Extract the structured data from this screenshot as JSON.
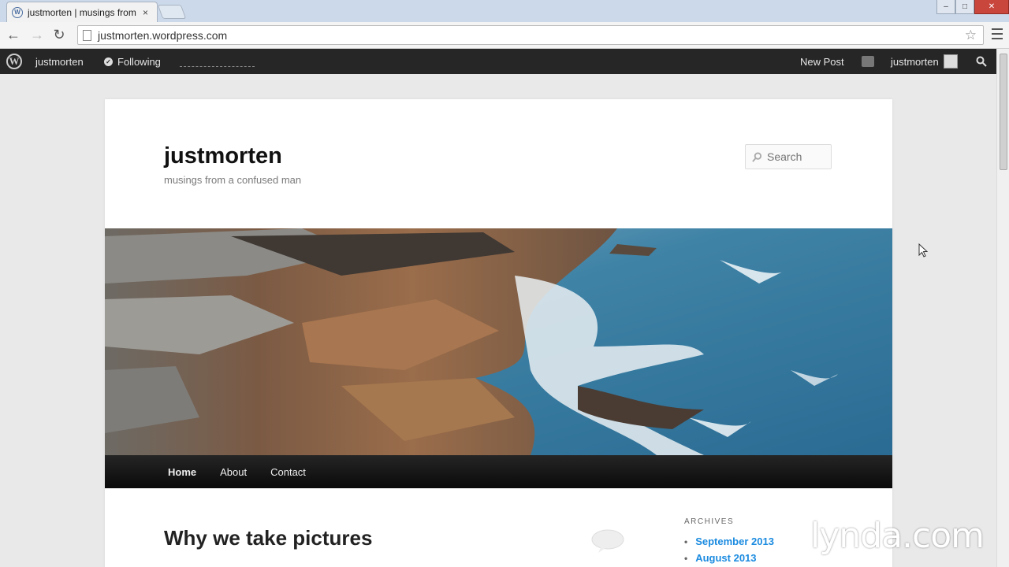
{
  "browser": {
    "tab_title": "justmorten | musings from",
    "tab_close": "×",
    "url": "justmorten.wordpress.com",
    "back": "←",
    "forward": "→",
    "reload": "↻",
    "star": "☆",
    "win_min": "–",
    "win_max": "□",
    "win_close": "✕"
  },
  "adminbar": {
    "site_name": "justmorten",
    "following": "Following",
    "new_post": "New Post",
    "user": "justmorten"
  },
  "site": {
    "title": "justmorten",
    "description": "musings from a confused man",
    "search_placeholder": "Search"
  },
  "nav": {
    "items": [
      {
        "label": "Home"
      },
      {
        "label": "About"
      },
      {
        "label": "Contact"
      }
    ]
  },
  "post": {
    "title": "Why we take pictures"
  },
  "sidebar": {
    "widget_title": "ARCHIVES",
    "archives": [
      "September 2013",
      "August 2013"
    ]
  },
  "watermark": "lynda.com",
  "colors": {
    "adminbar": "#262626",
    "link": "#1b8be0",
    "nav": "#111111"
  }
}
